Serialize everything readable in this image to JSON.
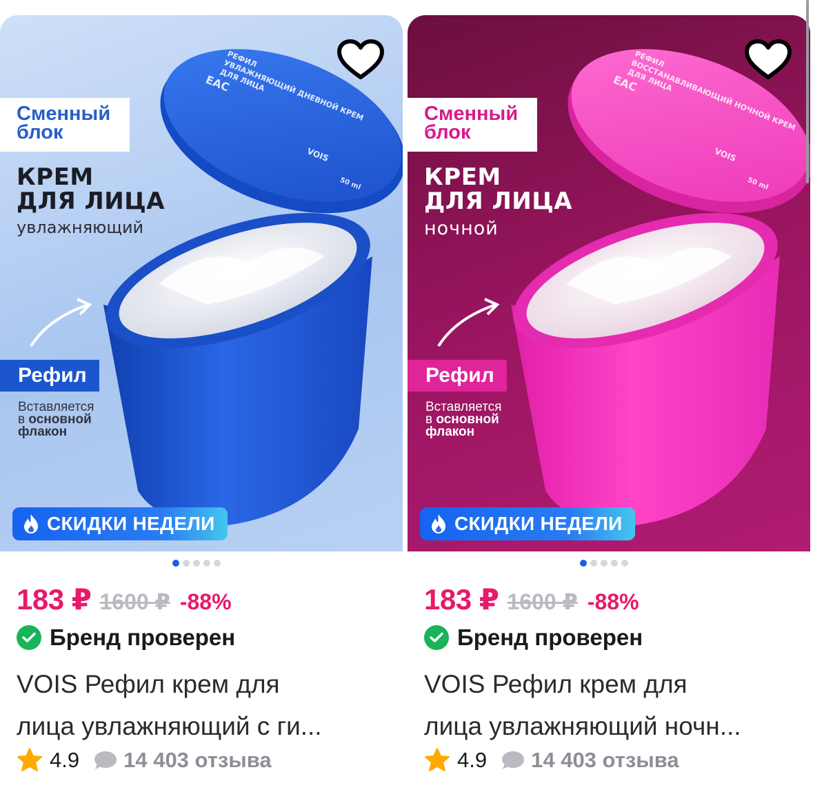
{
  "cards": [
    {
      "badge_line1": "Сменный",
      "badge_line2": "блок",
      "headline_line1": "КРЕМ",
      "headline_line2": "ДЛЯ ЛИЦА",
      "headline_sub": "увлажняющий",
      "refil_label": "Рефил",
      "inserted_line1": "Вставляется",
      "inserted_line2_prefix": "в",
      "inserted_line2_bold": "основной",
      "inserted_line3": "флакон",
      "lid_text_1": "РЕФИЛ",
      "lid_text_2": "УВЛАЖНЯЮЩИЙ ДНЕВНОЙ КРЕМ",
      "lid_text_3": "ДЛЯ ЛИЦА",
      "lid_logo": "EAC",
      "lid_brand": "VOIS",
      "lid_volume": "50 ml",
      "deals_label": "СКИДКИ НЕДЕЛИ",
      "price": "183 ₽",
      "old_price": "1600 ₽",
      "discount": "-88%",
      "brand_verified": "Бренд проверен",
      "title_line1": "VOIS Рефил крем для",
      "title_line2": "лица увлажняющий с ги...",
      "rating": "4.9",
      "reviews": "14 403 отзыва",
      "active_slide": 1,
      "slide_count": 5,
      "colors": {
        "product": "#1b56cf",
        "background": "#b8d1f3"
      }
    },
    {
      "badge_line1": "Сменный",
      "badge_line2": "блок",
      "headline_line1": "КРЕМ",
      "headline_line2": "ДЛЯ ЛИЦА",
      "headline_sub": "ночной",
      "refil_label": "Рефил",
      "inserted_line1": "Вставляется",
      "inserted_line2_prefix": "в",
      "inserted_line2_bold": "основной",
      "inserted_line3": "флакон",
      "lid_text_1": "РЕФИЛ",
      "lid_text_2": "ВОССТАНАВЛИВАЮЩИЙ НОЧНОЙ КРЕМ",
      "lid_text_3": "ДЛЯ ЛИЦА",
      "lid_logo": "EAC",
      "lid_brand": "VOIS",
      "lid_volume": "50 ml",
      "deals_label": "СКИДКИ НЕДЕЛИ",
      "price": "183 ₽",
      "old_price": "1600 ₽",
      "discount": "-88%",
      "brand_verified": "Бренд проверен",
      "title_line1": "VOIS Рефил крем для",
      "title_line2": "лица увлажняющий ночн...",
      "rating": "4.9",
      "reviews": "14 403 отзыва",
      "active_slide": 1,
      "slide_count": 5,
      "colors": {
        "product": "#ef2fb4",
        "background": "#9a1560"
      }
    }
  ],
  "icons": {
    "favorite": "heart-outline-icon",
    "deals": "fire-icon",
    "verified": "check-circle-icon",
    "rating": "star-icon",
    "reviews": "speech-bubble-icon"
  }
}
